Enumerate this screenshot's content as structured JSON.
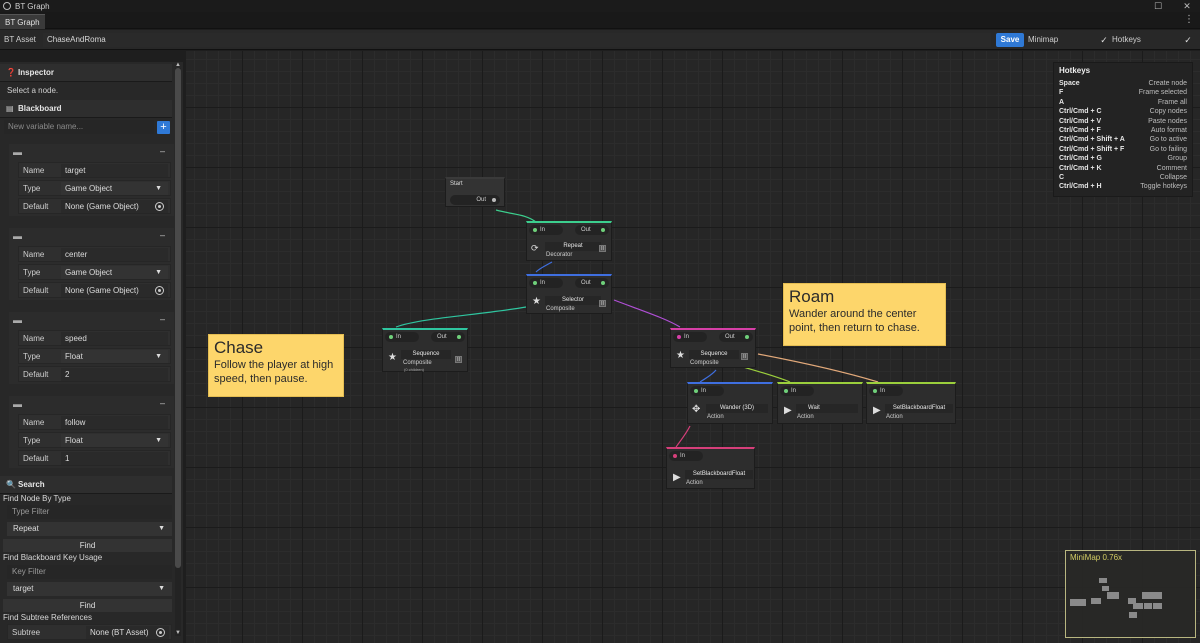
{
  "window": {
    "title": "BT Graph"
  },
  "tab": {
    "label": "BT Graph"
  },
  "toolbar": {
    "asset_label": "BT Asset",
    "asset_value": "ChaseAndRoma",
    "save_label": "Save",
    "minimap_label": "Minimap",
    "hotkeys_label": "Hotkeys"
  },
  "inspector": {
    "header": "Inspector",
    "hint": "Select a node."
  },
  "blackboard": {
    "header": "Blackboard",
    "new_var_placeholder": "New variable name...",
    "variables": [
      {
        "name_label": "Name",
        "name": "target",
        "type_label": "Type",
        "type": "Game Object",
        "default_label": "Default",
        "default": "None (Game Object)"
      },
      {
        "name_label": "Name",
        "name": "center",
        "type_label": "Type",
        "type": "Game Object",
        "default_label": "Default",
        "default": "None (Game Object)"
      },
      {
        "name_label": "Name",
        "name": "speed",
        "type_label": "Type",
        "type": "Float",
        "default_label": "Default",
        "default": "2"
      },
      {
        "name_label": "Name",
        "name": "follow",
        "type_label": "Type",
        "type": "Float",
        "default_label": "Default",
        "default": "1"
      }
    ]
  },
  "search": {
    "header": "Search",
    "by_type_label": "Find Node By Type",
    "type_filter_placeholder": "Type Filter",
    "type_selected": "Repeat",
    "find_label": "Find",
    "by_key_label": "Find Blackboard Key Usage",
    "key_filter_placeholder": "Key Filter",
    "key_selected": "target",
    "find2_label": "Find",
    "subtree_label": "Find Subtree References",
    "subtree_field_label": "Subtree",
    "subtree_value": "None (BT Asset)"
  },
  "nodes": {
    "start": {
      "title": "Start",
      "out": "Out"
    },
    "repeat": {
      "in": "In",
      "out": "Out",
      "title": "Repeat",
      "kind": "Decorator"
    },
    "selector": {
      "in": "In",
      "out": "Out",
      "title": "Selector",
      "kind": "Composite"
    },
    "seq_chase": {
      "in": "In",
      "out": "Out",
      "title": "Sequence",
      "kind": "Composite",
      "note": "(0 children)"
    },
    "seq_roam": {
      "in": "In",
      "out": "Out",
      "title": "Sequence",
      "kind": "Composite"
    },
    "wander": {
      "in": "In",
      "title": "Wander (3D)",
      "kind": "Action"
    },
    "wait": {
      "in": "In",
      "title": "Wait",
      "kind": "Action"
    },
    "setbb1": {
      "in": "In",
      "title": "SetBlackboardFloat",
      "kind": "Action"
    },
    "setbb2": {
      "in": "In",
      "title": "SetBlackboardFloat",
      "kind": "Action"
    }
  },
  "notes": {
    "chase": {
      "title": "Chase",
      "body": "Follow the player at high speed, then pause."
    },
    "roam": {
      "title": "Roam",
      "body": "Wander around the center point, then return to chase."
    }
  },
  "hotkeys": {
    "title": "Hotkeys",
    "rows": [
      {
        "key": "Space",
        "action": "Create node"
      },
      {
        "key": "F",
        "action": "Frame selected"
      },
      {
        "key": "A",
        "action": "Frame all"
      },
      {
        "key": "Ctrl/Cmd + C",
        "action": "Copy nodes"
      },
      {
        "key": "Ctrl/Cmd + V",
        "action": "Paste nodes"
      },
      {
        "key": "Ctrl/Cmd + F",
        "action": "Auto format"
      },
      {
        "key": "Ctrl/Cmd + Shift + A",
        "action": "Go to active"
      },
      {
        "key": "Ctrl/Cmd + Shift + F",
        "action": "Go to failing"
      },
      {
        "key": "Ctrl/Cmd + G",
        "action": "Group"
      },
      {
        "key": "Ctrl/Cmd + K",
        "action": "Comment"
      },
      {
        "key": "C",
        "action": "Collapse"
      },
      {
        "key": "Ctrl/Cmd + H",
        "action": "Toggle hotkeys"
      }
    ]
  },
  "minimap": {
    "label": "MiniMap  0.76x"
  },
  "colors": {
    "accent": "#2f79d6",
    "decorator": "#3ccf8e",
    "composite": "#3f6fe0",
    "composite_chase": "#2fc6a0",
    "composite_roam": "#d63fa7",
    "action_wander": "#3f6fe0",
    "action_green": "#9bcf3c",
    "action_pink": "#d63f7a",
    "sticky": "#fdd66b"
  }
}
